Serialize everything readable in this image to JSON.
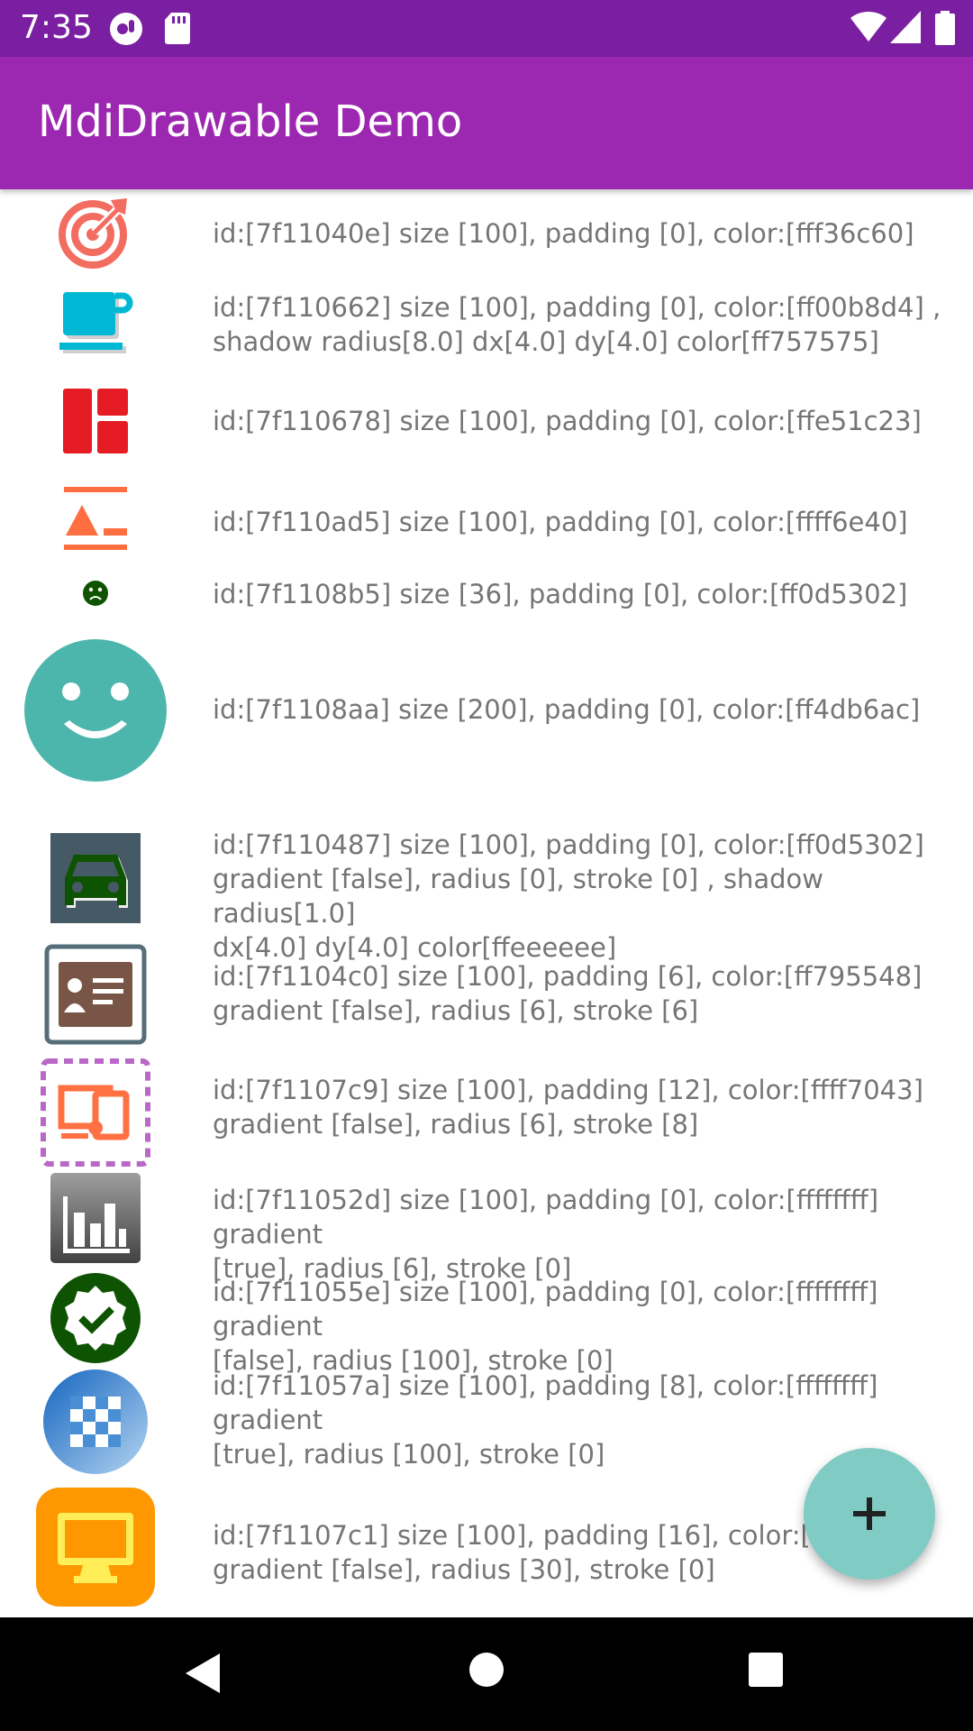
{
  "status_bar": {
    "time": "7:35",
    "icons": [
      "notification-badge-icon",
      "sd-card-icon",
      "wifi-icon",
      "signal-icon",
      "battery-icon"
    ]
  },
  "app_bar": {
    "title": "MdiDrawable Demo"
  },
  "rows": [
    {
      "icon": "target-arrow-icon",
      "color": "#f36c60",
      "text": "id:[7f11040e] size [100], padding [0], color:[fff36c60]"
    },
    {
      "icon": "coffee-cup-icon",
      "color": "#00b8d4",
      "text": "id:[7f110662] size [100], padding [0], color:[ff00b8d4] ,\nshadow radius[8.0] dx[4.0] dy[4.0] color[ff757575]"
    },
    {
      "icon": "view-dashboard-icon",
      "color": "#e51c23",
      "text": "id:[7f110678] size [100], padding [0], color:[ffe51c23]"
    },
    {
      "icon": "format-align-shape-icon",
      "color": "#ff6e40",
      "text": "id:[7f110ad5] size [100], padding [0], color:[ffff6e40]"
    },
    {
      "icon": "emoticon-sad-icon",
      "color": "#0d5302",
      "text": "id:[7f1108b5] size [36], padding [0], color:[ff0d5302]"
    },
    {
      "icon": "emoticon-happy-icon",
      "color": "#4db6ac",
      "text": "id:[7f1108aa] size [200], padding [0], color:[ff4db6ac]"
    },
    {
      "icon": "car-icon",
      "color": "#0d5302",
      "text": "id:[7f110487] size [100], padding [0], color:[ff0d5302]\ngradient [false], radius [0], stroke [0] , shadow radius[1.0]\ndx[4.0] dy[4.0] color[ffeeeeee]"
    },
    {
      "icon": "account-card-icon",
      "color": "#795548",
      "text": "id:[7f1104c0] size [100], padding [6], color:[ff795548]\ngradient [false], radius [6], stroke [6]"
    },
    {
      "icon": "devices-icon",
      "color": "#ff7043",
      "text": "id:[7f1107c9] size [100], padding [12], color:[ffff7043]\ngradient [false], radius [6], stroke [8]"
    },
    {
      "icon": "chart-bar-icon",
      "color": "#ffffff",
      "text": "id:[7f11052d] size [100], padding [0], color:[ffffffff] gradient\n[true], radius [6], stroke [0]"
    },
    {
      "icon": "check-decagram-icon",
      "color": "#ffffff",
      "text": "id:[7f11055e] size [100], padding [0], color:[ffffffff] gradient\n[false], radius [100], stroke [0]"
    },
    {
      "icon": "checkerboard-icon",
      "color": "#ffffff",
      "text": "id:[7f11057a] size [100], padding [8], color:[ffffffff] gradient\n[true], radius [100], stroke [0]"
    },
    {
      "icon": "monitor-icon",
      "color": "#ffee58",
      "text": "id:[7f1107c1] size [100], padding [16], color:[fffe\ngradient [false], radius [30], stroke [0]"
    }
  ],
  "fab": {
    "icon": "plus-icon"
  },
  "nav_bar": {
    "buttons": [
      "back-icon",
      "home-icon",
      "recents-icon"
    ]
  }
}
